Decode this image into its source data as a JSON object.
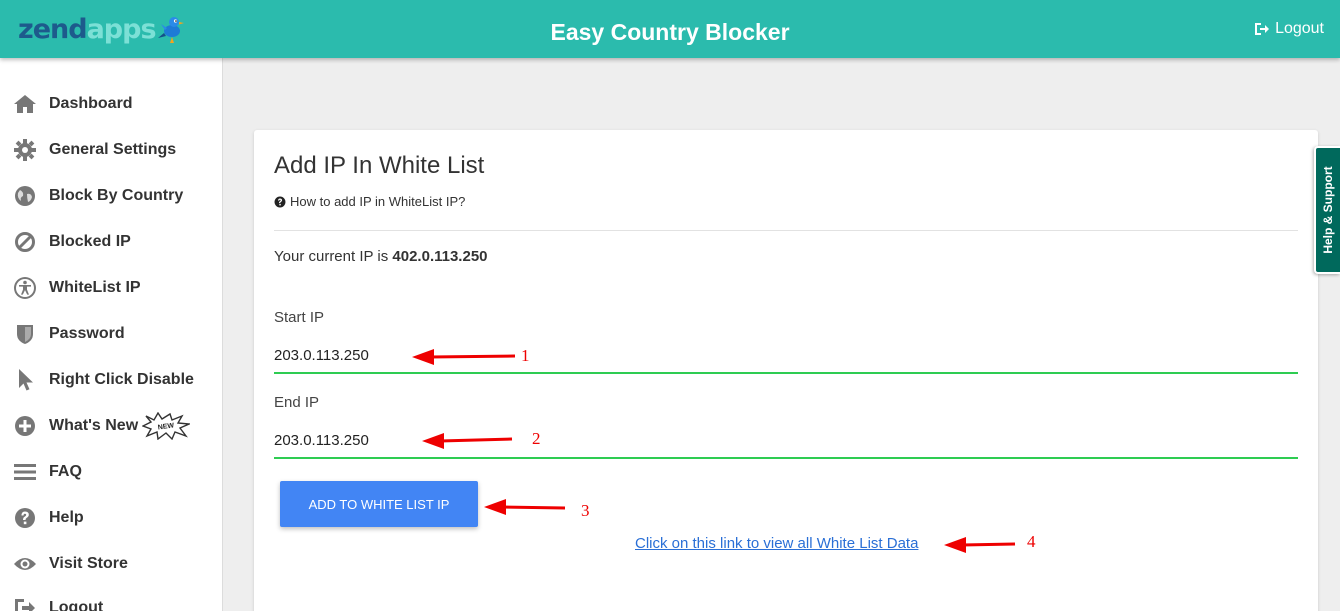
{
  "header": {
    "logo_text_main": "zend",
    "logo_text_accent": "apps",
    "logo_icon": "bird-icon",
    "title": "Easy Country Blocker",
    "logout_label": "Logout",
    "logout_icon": "sign-out-icon",
    "bar_color": "#2bbbad"
  },
  "sidebar": {
    "items": [
      {
        "label": "Dashboard",
        "icon": "home-icon"
      },
      {
        "label": "General Settings",
        "icon": "gear-icon"
      },
      {
        "label": "Block By Country",
        "icon": "globe-icon"
      },
      {
        "label": "Blocked IP",
        "icon": "ban-icon"
      },
      {
        "label": "WhiteList IP",
        "icon": "accessibility-icon"
      },
      {
        "label": "Password",
        "icon": "shield-icon"
      },
      {
        "label": "Right Click Disable",
        "icon": "cursor-icon"
      },
      {
        "label": "What's New",
        "icon": "plus-circle-icon",
        "badge": "NEW"
      },
      {
        "label": "FAQ",
        "icon": "menu-icon"
      },
      {
        "label": "Help",
        "icon": "question-circle-icon"
      },
      {
        "label": "Visit Store",
        "icon": "eye-icon"
      },
      {
        "label": "Logout",
        "icon": "sign-out-icon"
      }
    ]
  },
  "main": {
    "title": "Add IP In White List",
    "howto_label": "How to add IP in WhiteList IP?",
    "current_ip_prefix": "Your current IP is ",
    "current_ip_value": "402.0.113.250",
    "start_ip": {
      "label": "Start IP",
      "value": "203.0.113.250"
    },
    "end_ip": {
      "label": "End IP",
      "value": "203.0.113.250"
    },
    "add_button_label": "ADD TO WHITE LIST IP",
    "view_link_label": "Click on this link to view all White List Data",
    "input_underline_color": "#2ecc52",
    "button_color": "#4285f4"
  },
  "annotations": {
    "labels": [
      "1",
      "2",
      "3",
      "4"
    ],
    "color": "#ee0000"
  },
  "help_tab": {
    "label": "Help & Support",
    "color": "#00695c"
  }
}
